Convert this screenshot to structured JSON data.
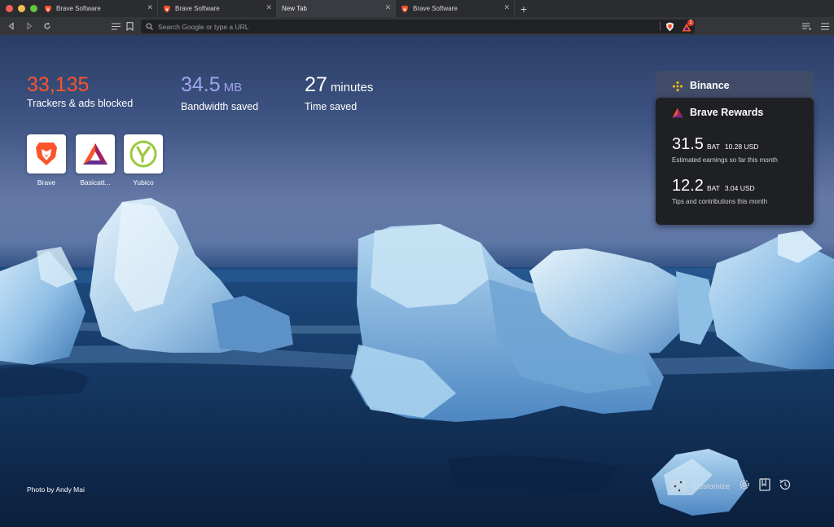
{
  "window": {
    "traffic_lights": [
      "#ee5f57",
      "#f5bd4f",
      "#5fc73f"
    ]
  },
  "tabs": [
    {
      "title": "Brave Software",
      "favicon": "brave-lion-icon",
      "active": false
    },
    {
      "title": "Brave Software",
      "favicon": "brave-lion-icon",
      "active": false
    },
    {
      "title": "New Tab",
      "favicon": "",
      "active": true
    },
    {
      "title": "Brave Software",
      "favicon": "brave-lion-icon",
      "active": false
    }
  ],
  "toolbar": {
    "search_placeholder": "Search Google or type a URL",
    "rewards_badge": "2"
  },
  "stats": {
    "trackers": {
      "value": "33,135",
      "unit": "",
      "label": "Trackers & ads blocked",
      "color": "#fb542b"
    },
    "bandwidth": {
      "value": "34.5",
      "unit": "MB",
      "label": "Bandwidth saved",
      "color": "#a0a5eb"
    },
    "time": {
      "value": "27",
      "unit": "minutes",
      "label": "Time saved",
      "color": "#ffffff"
    }
  },
  "top_sites": [
    {
      "label": "Brave",
      "icon": "brave-lion-icon"
    },
    {
      "label": "Basicatt...",
      "icon": "bat-triangle-icon"
    },
    {
      "label": "Yubico",
      "icon": "yubico-icon"
    }
  ],
  "widgets": {
    "binance": {
      "title": "Binance",
      "icon": "binance-icon"
    },
    "rewards": {
      "title": "Brave Rewards",
      "icon": "bat-triangle-icon",
      "earnings": {
        "amount": "31.5",
        "unit": "BAT",
        "usd": "10.28 USD",
        "label": "Estimated earnings so far this month"
      },
      "tips": {
        "amount": "12.2",
        "unit": "BAT",
        "usd": "3.04 USD",
        "label": "Tips and contributions this month"
      }
    }
  },
  "footer": {
    "photo_credit": "Photo by Andy Mai",
    "customize_label": "Customize"
  }
}
